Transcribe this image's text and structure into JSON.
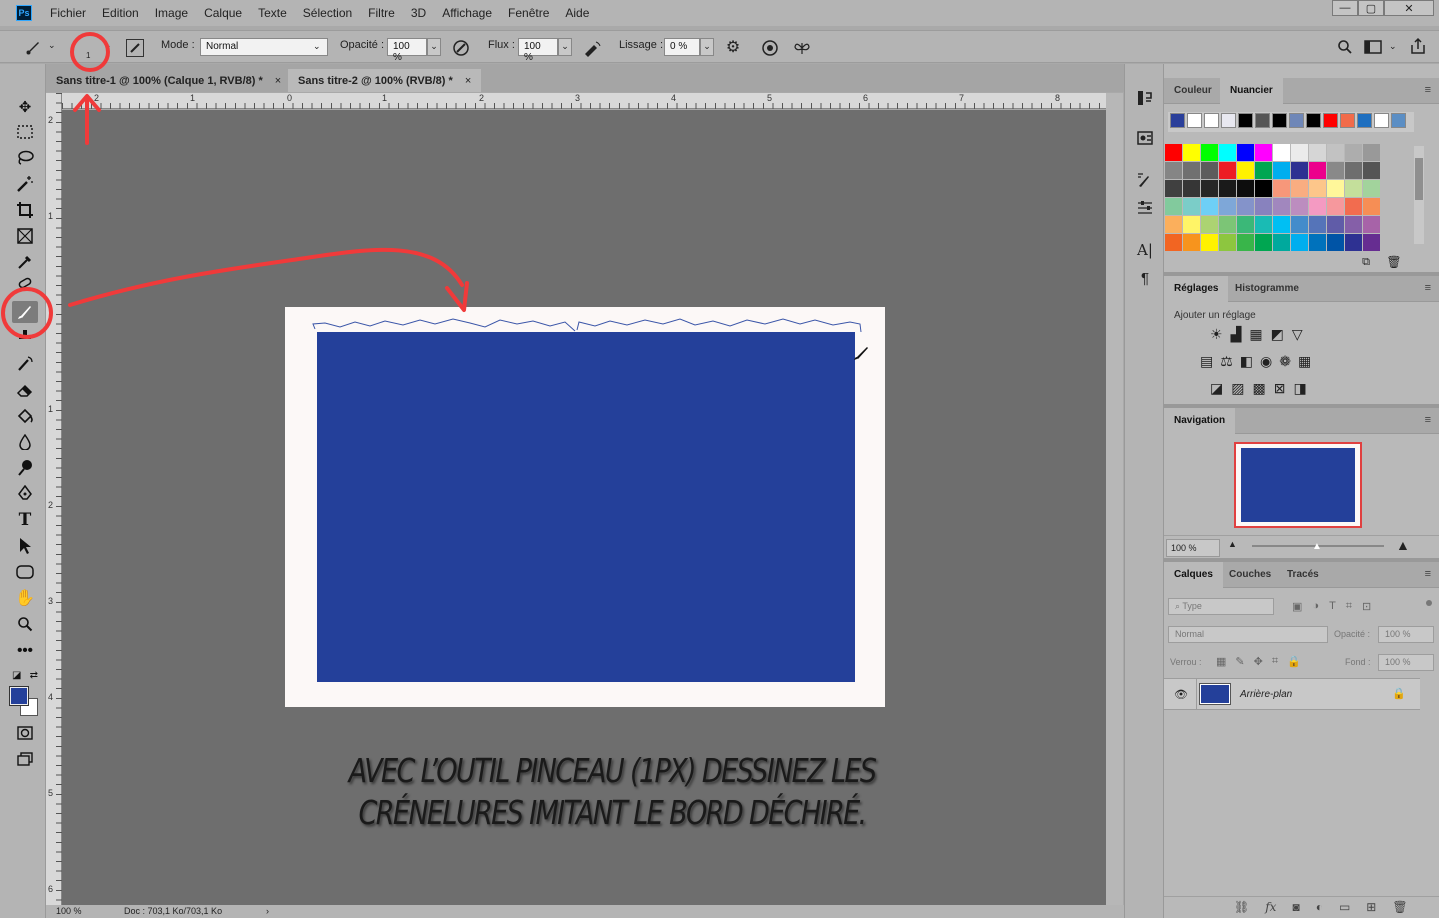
{
  "menu": {
    "logo": "Ps",
    "items": [
      "Fichier",
      "Edition",
      "Image",
      "Calque",
      "Texte",
      "Sélection",
      "Filtre",
      "3D",
      "Affichage",
      "Fenêtre",
      "Aide"
    ],
    "window_controls": [
      "—",
      "▢",
      "✕"
    ]
  },
  "options": {
    "brush_size_annotation": "1",
    "mode_label": "Mode :",
    "mode_value": "Normal",
    "opacity_label": "Opacité :",
    "opacity_value": "100 %",
    "flow_label": "Flux :",
    "flow_value": "100 %",
    "smoothing_label": "Lissage :",
    "smoothing_value": "0 %"
  },
  "tabs": [
    {
      "label": "Sans titre-1 @ 100% (Calque 1, RVB/8) *",
      "close": "×"
    },
    {
      "label": "Sans titre-2 @ 100% (RVB/8) *",
      "close": "×"
    }
  ],
  "ruler": {
    "top": [
      "2",
      "1",
      "0",
      "1",
      "2",
      "3",
      "4",
      "5",
      "6",
      "7",
      "8"
    ],
    "left": [
      "2",
      "1",
      "1",
      "2",
      "3",
      "4",
      "5",
      "6"
    ]
  },
  "caption": {
    "line1": "AVEC L’OUTIL PINCEAU (1PX) DESSINEZ LES",
    "line2": "CRÉNELURES IMITANT LE BORD DÉCHIRÉ."
  },
  "status": {
    "zoom": "100 %",
    "doc": "Doc : 703,1 Ko/703,1 Ko",
    "arrow": "›"
  },
  "swatches_panel": {
    "tabs": [
      "Couleur",
      "Nuancier"
    ],
    "recent": [
      "#2a3f9a",
      "#ffffff",
      "#ffffff",
      "#e8e8f0",
      "#000000",
      "#555555",
      "#000000",
      "#6f87b8",
      "#000000",
      "#ff0000",
      "#f26b4a",
      "#1e6fc0",
      "#ffffff",
      "#5b8ec4"
    ],
    "grid": [
      [
        "#ff0000",
        "#ffff00",
        "#00ff00",
        "#00ffff",
        "#0000ff",
        "#ff00ff",
        "#ffffff",
        "#ebebeb",
        "#d6d6d6",
        "#c2c2c2",
        "#adadad",
        "#999999"
      ],
      [
        "#858585",
        "#707070",
        "#5c5c5c",
        "#ed1c24",
        "#fff200",
        "#00a651",
        "#00aeef",
        "#2e3192",
        "#ec008c",
        "#898989",
        "#6e6e6e",
        "#555555"
      ],
      [
        "#404040",
        "#363636",
        "#262626",
        "#1a1a1a",
        "#0d0d0d",
        "#000000",
        "#f7977a",
        "#f9ad81",
        "#fdc68a",
        "#fff79a",
        "#c4df9b",
        "#a2d39c"
      ],
      [
        "#82ca9d",
        "#7bcdc8",
        "#6ecff6",
        "#7ea7d8",
        "#8493ca",
        "#8882be",
        "#a187be",
        "#bc8dbf",
        "#f49ac2",
        "#f6989d",
        "#f26c4f",
        "#f68e55"
      ],
      [
        "#fbaf5c",
        "#fff467",
        "#acd372",
        "#7cc576",
        "#3bb878",
        "#1abbb4",
        "#00bff3",
        "#438ccb",
        "#5574b9",
        "#605ca8",
        "#855fa8",
        "#a763a8"
      ],
      [
        "#f26522",
        "#f7941d",
        "#fff200",
        "#8dc63f",
        "#39b54a",
        "#00a651",
        "#00a99d",
        "#00aeef",
        "#0072bc",
        "#0054a6",
        "#2e3192",
        "#662d91"
      ]
    ]
  },
  "adjustments_panel": {
    "tabs": [
      "Réglages",
      "Histogramme"
    ],
    "add_label": "Ajouter un réglage"
  },
  "navigator_panel": {
    "tab": "Navigation",
    "zoom": "100 %"
  },
  "layers_panel": {
    "tabs": [
      "Calques",
      "Couches",
      "Tracés"
    ],
    "filter_placeholder": "Type",
    "blend_mode": "Normal",
    "opacity_label": "Opacité :",
    "opacity_value": "100 %",
    "lock_label": "Verrou :",
    "fill_label": "Fond :",
    "fill_value": "100 %",
    "layers": [
      {
        "name": "Arrière-plan",
        "thumb_color": "#24409a"
      }
    ]
  },
  "colors": {
    "foreground": "#24409a",
    "background": "#ffffff",
    "document_fill": "#24409a",
    "annotation": "#f03a3a"
  }
}
